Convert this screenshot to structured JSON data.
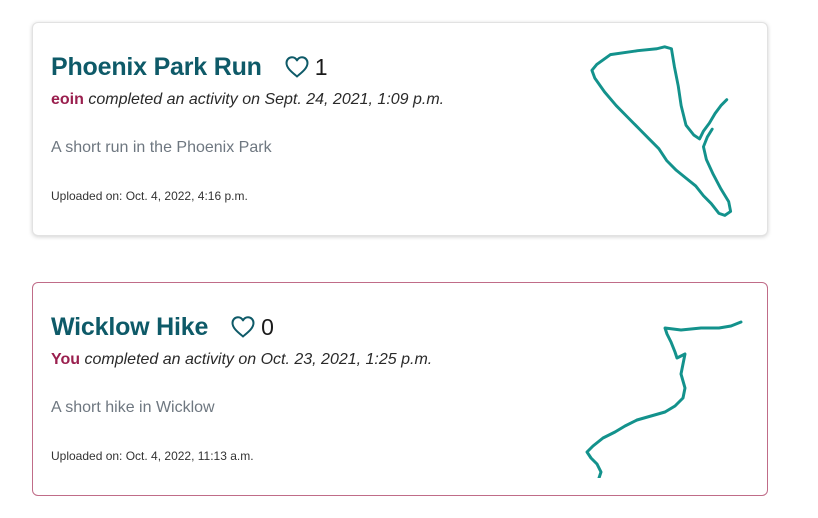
{
  "colors": {
    "title": "#0e5a68",
    "username": "#9a1f4e",
    "route": "#13928c",
    "highlight_border": "#c06c88"
  },
  "activities": [
    {
      "title": "Phoenix Park Run",
      "likes": "1",
      "like_icon": "heart-outline-icon",
      "user": "eoin",
      "completed_text": "completed an activity on Sept. 24, 2021, 1:09 p.m.",
      "description": "A short run in the Phoenix Park",
      "uploaded": "Uploaded on: Oct. 4, 2022, 4:16 p.m."
    },
    {
      "title": "Wicklow Hike",
      "likes": "0",
      "like_icon": "heart-outline-icon",
      "user": "You",
      "completed_text": "completed an activity on Oct. 23, 2021, 1:25 p.m.",
      "description": "A short hike in Wicklow",
      "uploaded": "Uploaded on: Oct. 4, 2022, 11:13 a.m."
    }
  ]
}
